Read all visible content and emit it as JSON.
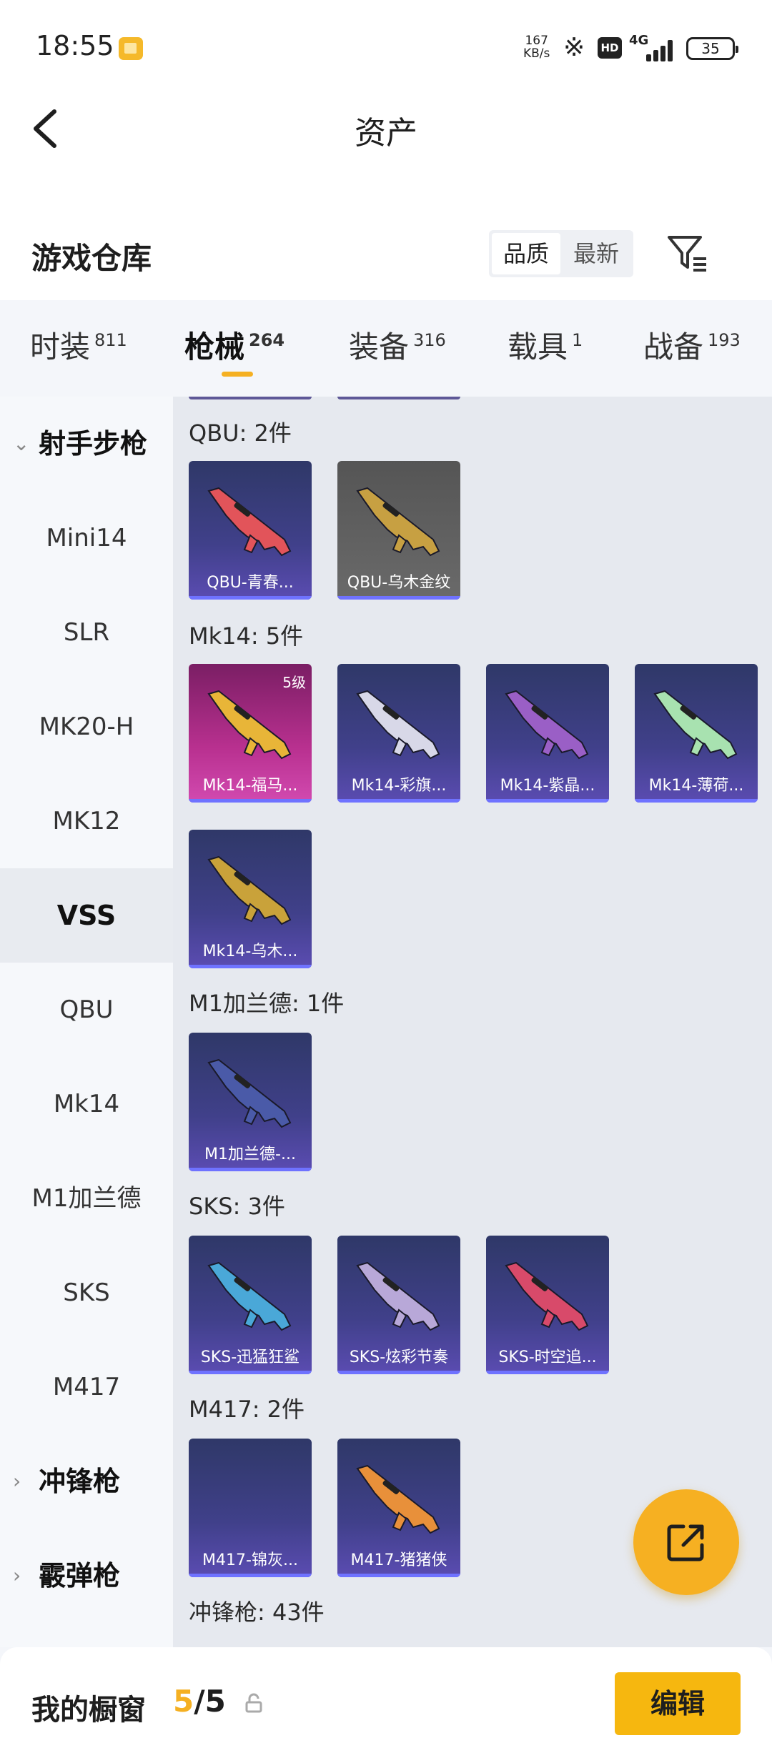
{
  "status_bar": {
    "time": "18:55",
    "net_speed_value": "167",
    "net_speed_unit": "KB/s",
    "network": "4G",
    "battery": "35"
  },
  "header": {
    "title": "资产"
  },
  "warehouse": {
    "title": "游戏仓库",
    "sort_options": [
      "品质",
      "最新"
    ]
  },
  "tabs": [
    {
      "label": "时装",
      "count": "811"
    },
    {
      "label": "枪械",
      "count": "264"
    },
    {
      "label": "装备",
      "count": "316"
    },
    {
      "label": "载具",
      "count": "1"
    },
    {
      "label": "战备",
      "count": "193"
    }
  ],
  "sidebar": {
    "group_open": "射手步枪",
    "items": [
      "Mini14",
      "SLR",
      "MK20-H",
      "MK12",
      "VSS",
      "QBU",
      "Mk14",
      "M1加兰德",
      "SKS",
      "M417"
    ],
    "active": "VSS",
    "groups_closed": [
      "冲锋枪",
      "霰弹枪"
    ]
  },
  "content": {
    "groups": [
      {
        "label": "QBU: 2件",
        "items": [
          {
            "name": "QBU-青春...",
            "style": "purple",
            "gun": "#e2545a"
          },
          {
            "name": "QBU-乌木金纹",
            "style": "gray",
            "gun": "#c7a042"
          }
        ]
      },
      {
        "label": "Mk14: 5件",
        "items": [
          {
            "name": "Mk14-福马...",
            "style": "pink",
            "gun": "#e8b538",
            "level": "5级"
          },
          {
            "name": "Mk14-彩旗...",
            "style": "purple",
            "gun": "#d8d8e8"
          },
          {
            "name": "Mk14-紫晶...",
            "style": "purple",
            "gun": "#9a5fc6"
          },
          {
            "name": "Mk14-薄荷...",
            "style": "purple",
            "gun": "#a8e2b0"
          },
          {
            "name": "Mk14-乌木...",
            "style": "purple",
            "gun": "#c9a23a"
          }
        ]
      },
      {
        "label": "M1加兰德: 1件",
        "items": [
          {
            "name": "M1加兰德-...",
            "style": "purple",
            "gun": "#4a5aa8"
          }
        ]
      },
      {
        "label": "SKS: 3件",
        "items": [
          {
            "name": "SKS-迅猛狂鲨",
            "style": "purple",
            "gun": "#4aa8d8"
          },
          {
            "name": "SKS-炫彩节奏",
            "style": "purple",
            "gun": "#b8a8d8"
          },
          {
            "name": "SKS-时空追...",
            "style": "purple",
            "gun": "#d84a6a"
          }
        ]
      },
      {
        "label": "M417: 2件",
        "items": [
          {
            "name": "M417-锦灰...",
            "style": "purple",
            "gun": ""
          },
          {
            "name": "M417-猪猪侠",
            "style": "purple",
            "gun": "#e8903a"
          }
        ]
      }
    ],
    "footer_label": "冲锋枪: 43件"
  },
  "showcase": {
    "label": "我的橱窗",
    "current": "5",
    "total": "/5",
    "edit_label": "编辑"
  },
  "colors": {
    "accent": "#f5b022",
    "card_purple": "#40408a",
    "card_pink": "#b8308f"
  }
}
